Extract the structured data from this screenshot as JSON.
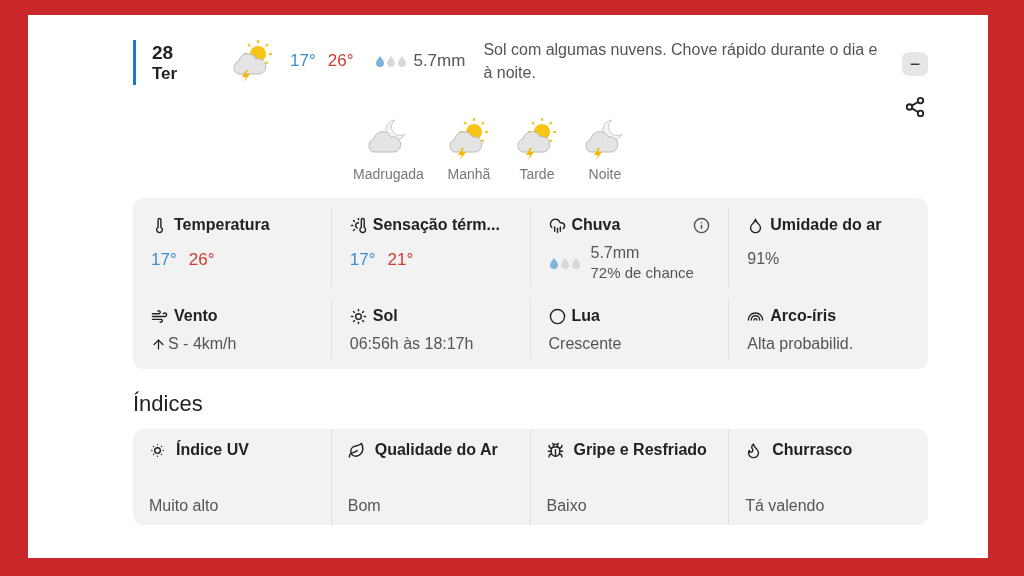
{
  "day": {
    "date": "28",
    "weekday": "Ter",
    "min": "17°",
    "max": "26°",
    "rain": {
      "level": 0.33,
      "amount": "5.7mm"
    },
    "description": "Sol com algumas nuvens. Chove rápido durante o dia e à noite.",
    "collapse_label": "−"
  },
  "periods": [
    {
      "label": "Madrugada"
    },
    {
      "label": "Manhã"
    },
    {
      "label": "Tarde"
    },
    {
      "label": "Noite"
    }
  ],
  "details": [
    {
      "kind": "minmax",
      "title": "Temperatura",
      "min": "17°",
      "max": "26°"
    },
    {
      "kind": "minmax",
      "title": "Sensação térm...",
      "min": "17°",
      "max": "21°"
    },
    {
      "kind": "rain",
      "title": "Chuva",
      "level": 0.33,
      "amount": "5.7mm",
      "chance": "72% de chance"
    },
    {
      "kind": "text",
      "title": "Umidade do ar",
      "value": "91%"
    },
    {
      "kind": "wind",
      "title": "Vento",
      "value": "S - 4km/h"
    },
    {
      "kind": "text",
      "title": "Sol",
      "value": "06:56h às 18:17h"
    },
    {
      "kind": "text",
      "title": "Lua",
      "value": "Crescente"
    },
    {
      "kind": "text",
      "title": "Arco-íris",
      "value": "Alta probabilid."
    }
  ],
  "indices": {
    "title": "Índices",
    "items": [
      {
        "title": "Índice UV",
        "value": "Muito alto"
      },
      {
        "title": "Qualidade do Ar",
        "value": "Bom"
      },
      {
        "title": "Gripe e Resfriado",
        "value": "Baixo"
      },
      {
        "title": "Churrasco",
        "value": "Tá valendo"
      }
    ]
  }
}
